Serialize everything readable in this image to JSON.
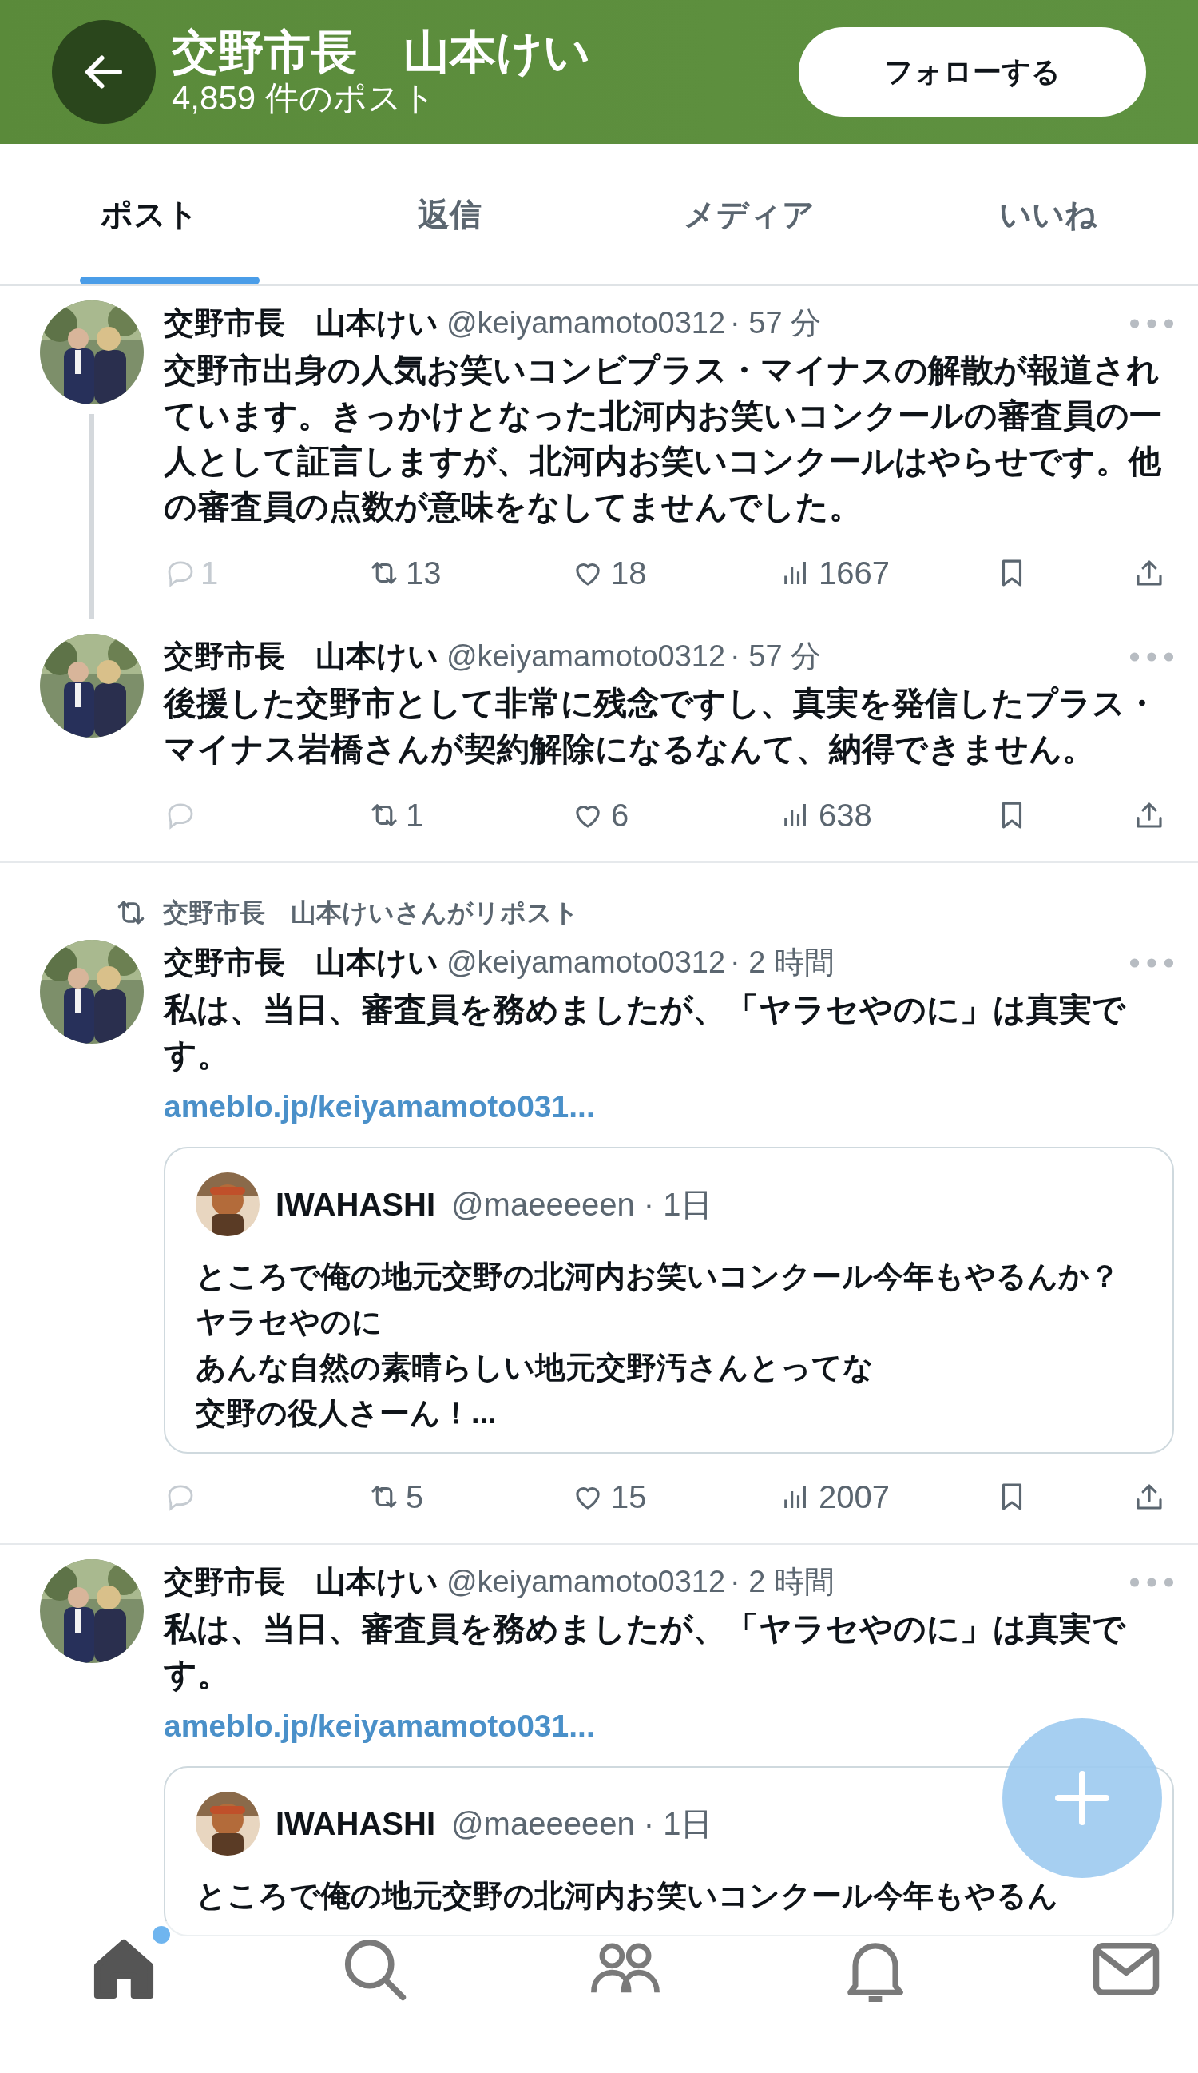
{
  "header": {
    "title": "交野市長　山本けい",
    "subtitle": "4,859 件のポスト",
    "follow_button": "フォローする"
  },
  "tabs": [
    {
      "label": "ポスト",
      "selected": true
    },
    {
      "label": "返信",
      "selected": false
    },
    {
      "label": "メディア",
      "selected": false
    },
    {
      "label": "いいね",
      "selected": false
    }
  ],
  "posts": [
    {
      "thread_line": true,
      "divider": false,
      "name": "交野市長　山本けい",
      "handle": "@keiyamamoto0312",
      "time": "· 57 分",
      "text": "交野市出身の人気お笑いコンビプラス・マイナスの解散が報道されています。きっかけとなった北河内お笑いコンクールの審査員の一人として証言しますが、北河内お笑いコンクールはやらせです。他の審査員の点数が意味をなしてませんでした。",
      "stats": {
        "replies": "1",
        "reposts": "13",
        "likes": "18",
        "views": "1667"
      }
    },
    {
      "thread_line": false,
      "name": "交野市長　山本けい",
      "handle": "@keiyamamoto0312",
      "time": "· 57 分",
      "text": "後援した交野市として非常に残念ですし、真実を発信したプラス・マイナス岩橋さんが契約解除になるなんて、納得できません。",
      "stats": {
        "reposts": "1",
        "likes": "6",
        "views": "638"
      },
      "divider": true
    },
    {
      "thread_line": false,
      "repost_label": "交野市長　山本けいさんがリポスト",
      "name": "交野市長　山本けい",
      "handle": "@keiyamamoto0312",
      "time": "· 2 時間",
      "text": "私は、当日、審査員を務めましたが、「ヤラセやのに」は真実です。",
      "link": "ameblo.jp/keiyamamoto031...",
      "quote": {
        "name": "IWAHASHI",
        "handle": "@maeeeeen",
        "time": "· 1日",
        "lines": [
          "ところで俺の地元交野の北河内お笑いコンクール今年もやるんか？",
          "ヤラセやのに",
          "あんな自然の素晴らしい地元交野汚さんとってな",
          "交野の役人さーん！..."
        ]
      },
      "stats": {
        "reposts": "5",
        "likes": "15",
        "views": "2007"
      },
      "divider": true
    },
    {
      "thread_line": false,
      "divider": false,
      "name": "交野市長　山本けい",
      "handle": "@keiyamamoto0312",
      "time": "· 2 時間",
      "text": "私は、当日、審査員を務めましたが、「ヤラセやのに」は真実です。",
      "link": "ameblo.jp/keiyamamoto031...",
      "quote": {
        "name": "IWAHASHI",
        "handle": "@maeeeeen",
        "time": "· 1日",
        "lines": [
          "ところで俺の地元交野の北河内お笑いコンクール今年もやるん"
        ]
      }
    }
  ],
  "bottom_nav": [
    {
      "kind": "home",
      "selected": true,
      "badge": true
    },
    {
      "kind": "search",
      "selected": false,
      "badge": false
    },
    {
      "kind": "people",
      "selected": false,
      "badge": false
    },
    {
      "kind": "bell",
      "selected": false,
      "badge": false
    },
    {
      "kind": "mail",
      "selected": false,
      "badge": false
    }
  ]
}
